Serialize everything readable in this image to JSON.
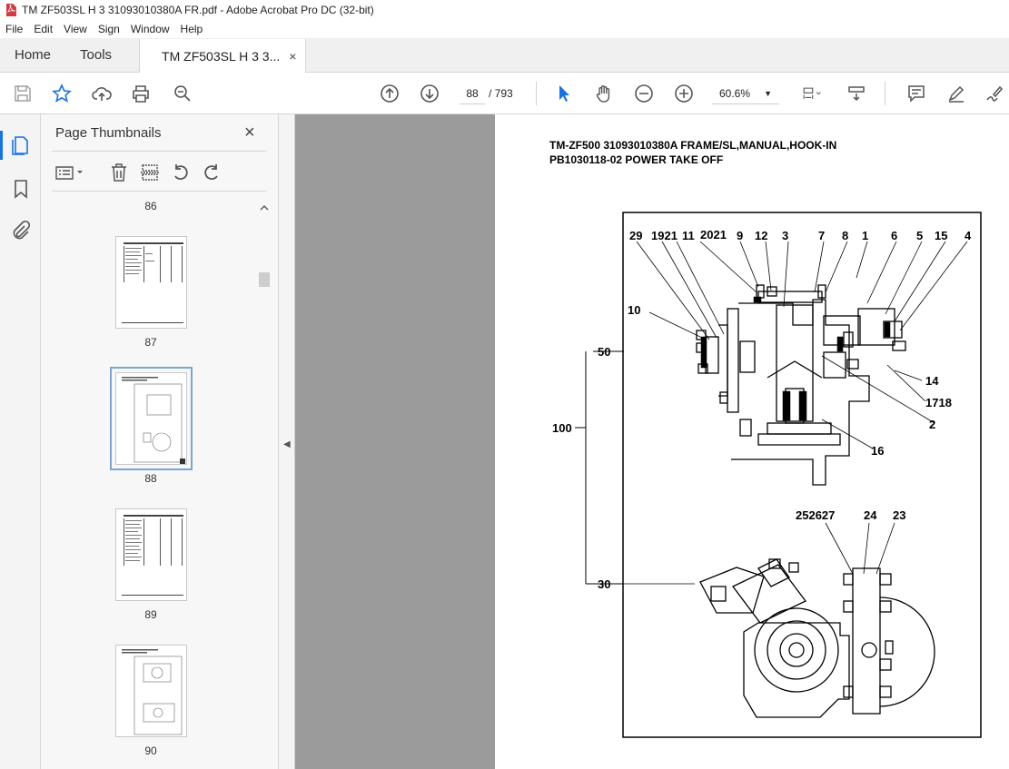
{
  "window": {
    "title": "TM ZF503SL H  3 31093010380A FR.pdf - Adobe Acrobat Pro DC (32-bit)"
  },
  "menu": [
    "File",
    "Edit",
    "View",
    "Sign",
    "Window",
    "Help"
  ],
  "tabs": {
    "home": "Home",
    "tools": "Tools",
    "document": "TM ZF503SL H  3 3...",
    "close": "×"
  },
  "toolbar": {
    "page_current": "88",
    "page_total": "/   793",
    "zoom": "60.6%"
  },
  "panel": {
    "title": "Page Thumbnails",
    "close": "×",
    "thumbnails": [
      {
        "label": "86"
      },
      {
        "label": "87"
      },
      {
        "label": "88",
        "selected": true
      },
      {
        "label": "89"
      },
      {
        "label": "90"
      }
    ]
  },
  "document": {
    "heading_line1": "TM-ZF500 31093010380A FRAME/SL,MANUAL,HOOK-IN",
    "heading_line2": "PB1030118-02 POWER TAKE OFF",
    "callouts": {
      "c29": "29",
      "c1921": "1921",
      "c11": "11",
      "c2021": "2021",
      "c9": "9",
      "c12": "12",
      "c3": "3",
      "c7": "7",
      "c8": "8",
      "c1": "1",
      "c6": "6",
      "c5": "5",
      "c15": "15",
      "c4": "4",
      "c10": "10",
      "c50": "50",
      "c14": "14",
      "c1718": "1718",
      "c2": "2",
      "c100": "100",
      "c16": "16",
      "c252627": "252627",
      "c24": "24",
      "c23": "23",
      "c30": "30"
    }
  },
  "colors": {
    "accent": "#1473e6",
    "viewer_bg": "#9b9b9b"
  }
}
